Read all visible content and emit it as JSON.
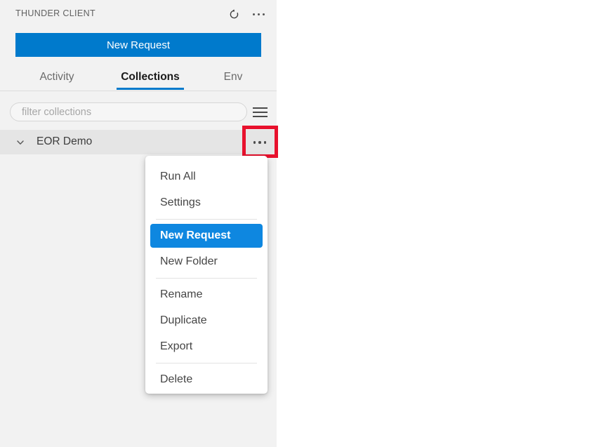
{
  "panel": {
    "title": "THUNDER CLIENT",
    "refresh_icon": "refresh-icon",
    "more_icon": "more-horizontal-icon",
    "new_request_label": "New Request",
    "tabs": [
      {
        "label": "Activity",
        "active": false
      },
      {
        "label": "Collections",
        "active": true
      },
      {
        "label": "Env",
        "active": false
      }
    ],
    "filter": {
      "placeholder": "filter collections",
      "value": ""
    },
    "menu_toggle_icon": "hamburger-menu-icon",
    "collection": {
      "name": "EOR Demo",
      "chevron_icon": "chevron-down-icon",
      "more_icon": "more-horizontal-icon"
    }
  },
  "context_menu": {
    "items": [
      {
        "label": "Run All",
        "selected": false
      },
      {
        "label": "Settings",
        "selected": false
      },
      {
        "label": "New Request",
        "selected": true
      },
      {
        "label": "New Folder",
        "selected": false
      },
      {
        "label": "Rename",
        "selected": false
      },
      {
        "label": "Duplicate",
        "selected": false
      },
      {
        "label": "Export",
        "selected": false
      },
      {
        "label": "Delete",
        "selected": false
      }
    ]
  },
  "annotation": {
    "highlight_color": "#e8112d",
    "target": "collection-more-button"
  },
  "colors": {
    "accent": "#007acc",
    "menu_selected": "#0e87e0",
    "panel_background": "#f2f2f2",
    "row_background": "#e5e5e5"
  }
}
